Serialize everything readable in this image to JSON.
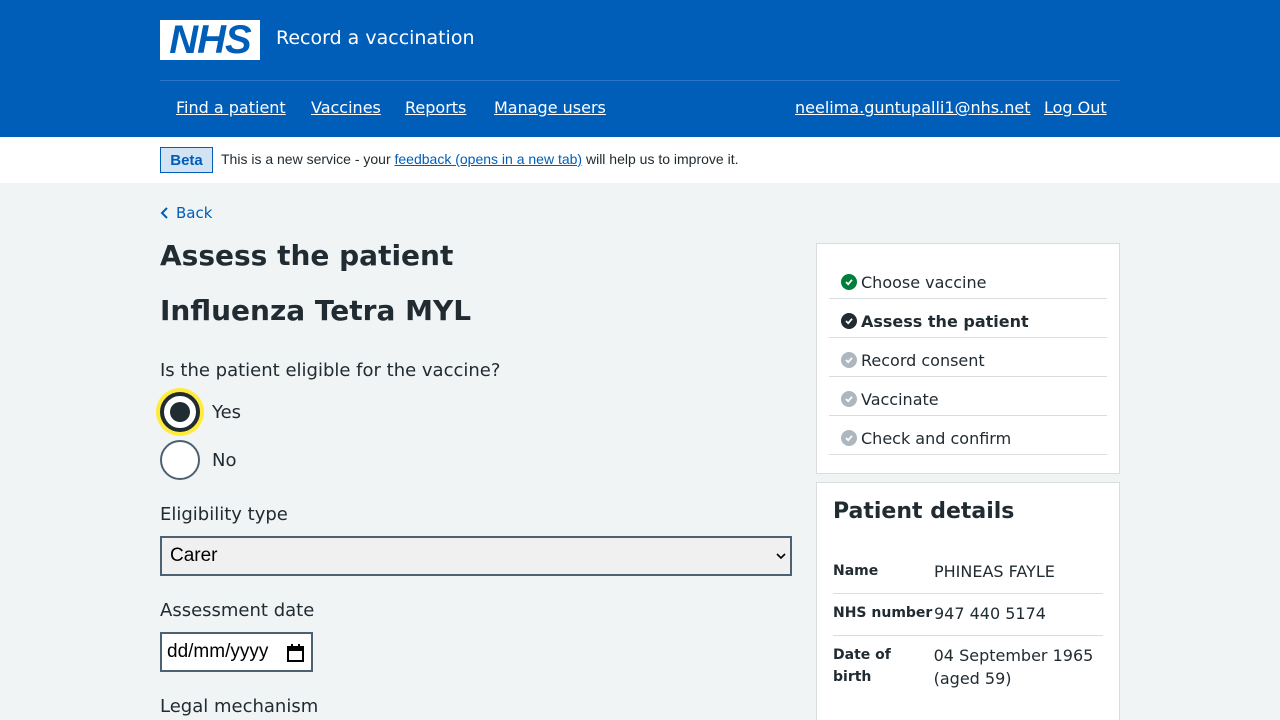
{
  "header": {
    "logo_text": "NHS",
    "service_name": "Record a vaccination",
    "nav": [
      "Find a patient",
      "Vaccines",
      "Reports",
      "Manage users"
    ],
    "user_email": "neelima.guntupalli1@nhs.net",
    "logout": "Log Out"
  },
  "beta": {
    "tag": "Beta",
    "text_before": "This is a new service - your ",
    "link": "feedback (opens in a new tab)",
    "text_after": " will help us to improve it."
  },
  "back": "Back",
  "page_title": "Assess the patient",
  "vaccine_name": "Influenza Tetra MYL",
  "question": "Is the patient eligible for the vaccine?",
  "radios": [
    {
      "label": "Yes",
      "checked": true
    },
    {
      "label": "No",
      "checked": false
    }
  ],
  "eligibility": {
    "label": "Eligibility type",
    "value": "Carer"
  },
  "assessment_date": {
    "label": "Assessment date",
    "placeholder": "dd/mm/yyyy"
  },
  "legal_mechanism": {
    "label": "Legal mechanism"
  },
  "steps": [
    {
      "label": "Choose vaccine",
      "status": "done",
      "color": "#007f3b"
    },
    {
      "label": "Assess the patient",
      "status": "current",
      "color": "#212b32"
    },
    {
      "label": "Record consent",
      "status": "todo",
      "color": "#aeb7bd"
    },
    {
      "label": "Vaccinate",
      "status": "todo",
      "color": "#aeb7bd"
    },
    {
      "label": "Check and confirm",
      "status": "todo",
      "color": "#aeb7bd"
    }
  ],
  "patient": {
    "title": "Patient details",
    "rows": [
      {
        "key": "Name",
        "value": "PHINEAS FAYLE"
      },
      {
        "key": "NHS number",
        "value": "947 440 5174"
      },
      {
        "key": "Date of birth",
        "value": "04 September 1965 (aged 59)"
      }
    ]
  }
}
